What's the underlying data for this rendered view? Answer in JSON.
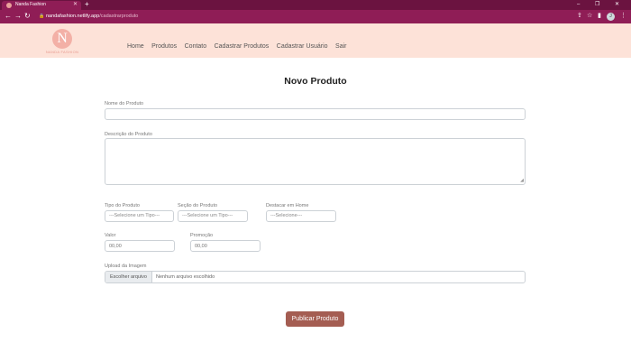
{
  "browser": {
    "tab_title": "Nanda Fashion",
    "tab_close": "✕",
    "new_tab": "+",
    "window_controls": [
      "–",
      "❐",
      "✕"
    ],
    "nav": {
      "back": "←",
      "forward": "→",
      "reload": "↻"
    },
    "lock": "🔒",
    "url_host": "nandafashion.netlify.app",
    "url_path": "/cadastrarproduto",
    "toolbar_icons": [
      "⇪",
      "☆",
      "▮",
      "⋮"
    ],
    "profile_initial": "J"
  },
  "site": {
    "logo_letter": "N",
    "logo_text": "NANDA FASHION",
    "menu": [
      "Home",
      "Produtos",
      "Contato",
      "Cadastrar Produtos",
      "Cadastrar Usuário",
      "Sair"
    ]
  },
  "form": {
    "title": "Novo Produto",
    "nome_label": "Nome do Produto",
    "nome_value": "",
    "descricao_label": "Descrição do Produto",
    "descricao_value": "",
    "resize_grip": "◢",
    "tipo_label": "Tipo do Produto",
    "tipo_selected": "---Selecione um Tipo---",
    "secao_label": "Seção do Produto",
    "secao_selected": "---Selecione um Tipo---",
    "destacar_label": "Destacar em Home",
    "destacar_selected": "---Selecione---",
    "valor_label": "Valor",
    "valor_placeholder": "00,00",
    "promocao_label": "Promoção",
    "promocao_placeholder": "00,00",
    "upload_label": "Upload da Imagem",
    "file_button": "Escolher arquivo",
    "file_status": "Nenhum arquivo escolhido",
    "submit_label": "Publicar Produto"
  },
  "colors": {
    "browser_frame": "#6b1340",
    "header_bg": "#fde2d8",
    "accent_button": "#a45d52",
    "logo": "#f3b0a6"
  }
}
